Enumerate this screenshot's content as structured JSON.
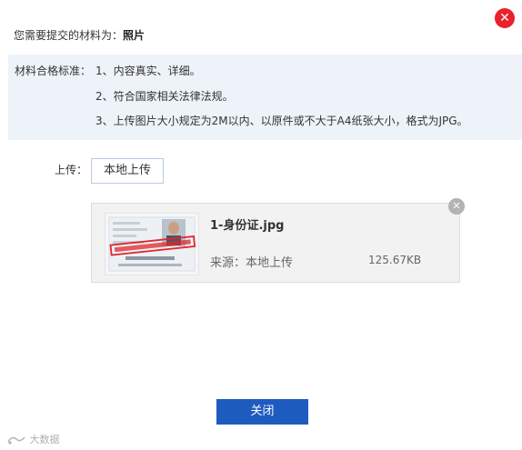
{
  "dialog": {
    "close_glyph": "✕",
    "title_prefix": "您需要提交的材料为：",
    "title_value": "照片"
  },
  "criteria": {
    "label": "材料合格标准：",
    "items": [
      "1、内容真实、详细。",
      "2、符合国家相关法律法规。",
      "3、上传图片大小规定为2M以内、以原件或不大于A4纸张大小，格式为JPG。"
    ]
  },
  "upload": {
    "label": "上传：",
    "button_label": "本地上传"
  },
  "file": {
    "name": "1-身份证.jpg",
    "source": "来源：本地上传",
    "size": "125.67KB",
    "remove_glyph": "✕"
  },
  "footer": {
    "close_button_label": "关闭"
  },
  "watermark": "大数据"
}
